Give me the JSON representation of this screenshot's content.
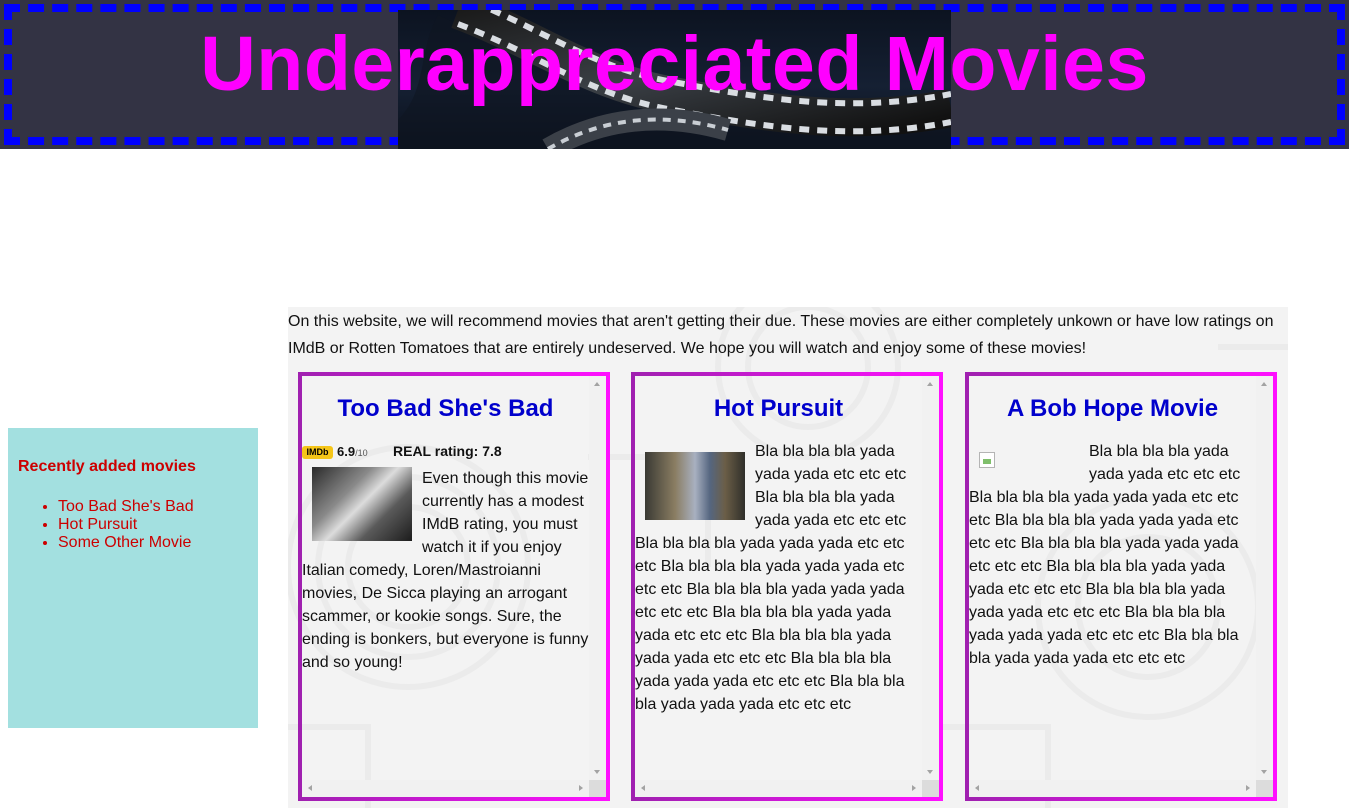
{
  "header": {
    "title": "Underappreciated Movies",
    "border_color": "#0000ff",
    "title_color": "#ff00ff",
    "background": "#333344"
  },
  "sidebar": {
    "heading": "Recently added movies",
    "items": [
      {
        "label": "Too Bad She's Bad"
      },
      {
        "label": "Hot Pursuit"
      },
      {
        "label": "Some Other Movie"
      }
    ],
    "background": "#a3e0e0",
    "text_color": "#cc0000"
  },
  "main": {
    "intro": "On this website, we will recommend movies that aren't getting their due. These movies are either completely unkown or have low ratings on IMdB or Rotten Tomatoes that are entirely undeserved. We hope you will watch and enjoy some of these movies!",
    "cards": [
      {
        "title": "Too Bad She's Bad",
        "imdb_badge": "IMDb",
        "imdb_score": "6.9",
        "imdb_scale": "/10",
        "real_rating": "REAL rating: 7.8",
        "text": "Even though this movie currently has a modest IMdB rating, you must watch it if you enjoy Italian comedy, Loren/Mastroianni movies, De Sicca playing an arrogant scammer, or kookie songs. Sure, the ending is bonkers, but everyone is funny and so young!"
      },
      {
        "title": "Hot Pursuit",
        "text": "Bla bla bla bla yada yada yada etc etc etc Bla bla bla bla yada yada yada etc etc etc Bla bla bla bla yada yada yada etc etc etc Bla bla bla bla yada yada yada etc etc etc Bla bla bla bla yada yada yada etc etc etc Bla bla bla bla yada yada yada etc etc etc Bla bla bla bla yada yada yada etc etc etc Bla bla bla bla yada yada yada etc etc etc Bla bla bla bla yada yada yada etc etc etc"
      },
      {
        "title": "A Bob Hope Movie",
        "text": "Bla bla bla bla yada yada yada etc etc etc Bla bla bla bla yada yada yada etc etc etc Bla bla bla bla yada yada yada etc etc etc Bla bla bla bla yada yada yada etc etc etc Bla bla bla bla yada yada yada etc etc etc Bla bla bla bla yada yada yada etc etc etc Bla bla bla bla yada yada yada etc etc etc Bla bla bla bla yada yada yada etc etc etc"
      }
    ],
    "card_title_color": "#0000cc",
    "card_border_color": "#ff10ff"
  }
}
